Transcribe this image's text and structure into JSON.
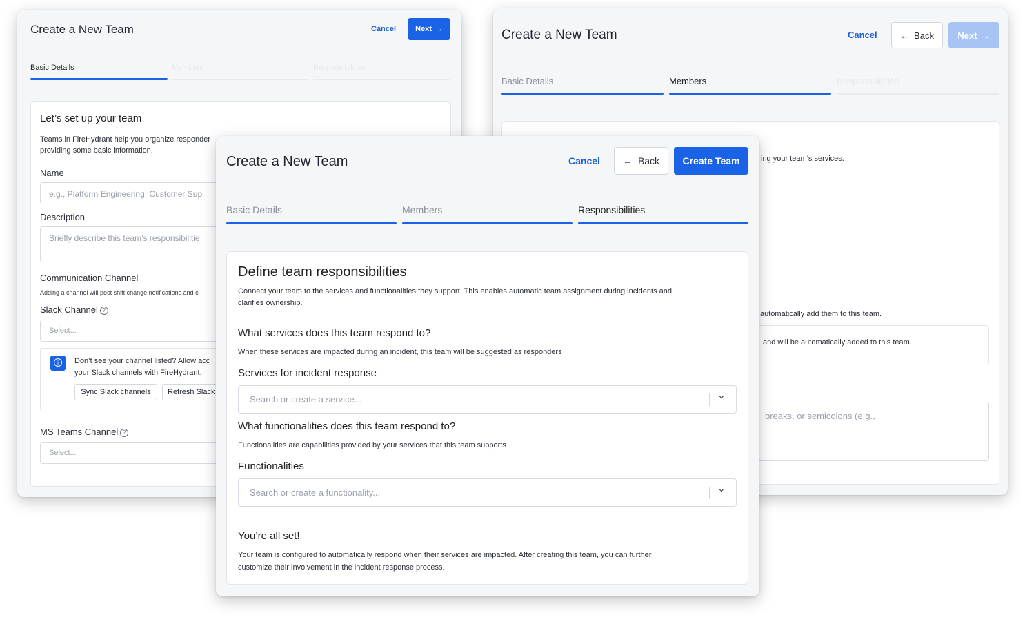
{
  "back_window_left": {
    "title": "Create a New Team",
    "cancel": "Cancel",
    "next": "Next",
    "tabs": [
      "Basic Details",
      "Members",
      "Responsibilities"
    ],
    "card_heading": "Let’s set up your team",
    "intro_line1": "Teams in FireHydrant help you organize responder",
    "intro_line2": "providing some basic information.",
    "name_label": "Name",
    "name_placeholder": "e.g., Platform Engineering, Customer Sup",
    "description_label": "Description",
    "description_placeholder": "Briefly describe this team’s responsibilitie",
    "comm_label": "Communication Channel",
    "comm_help": "Adding a channel will post shift change notifications and c",
    "slack_label": "Slack Channel",
    "slack_placeholder": "Select...",
    "info_line1": "Don’t see your channel listed? Allow acc",
    "info_line2": "your Slack channels with FireHydrant.",
    "sync_button": "Sync Slack channels",
    "refresh_button": "Refresh Slack",
    "ms_label": "MS Teams Channel",
    "ms_placeholder": "Select..."
  },
  "back_window_right": {
    "title": "Create a New Team",
    "cancel": "Cancel",
    "back": "Back",
    "next": "Next",
    "tabs": [
      "Basic Details",
      "Members",
      "Responsibilities"
    ],
    "text_services": "ing your team’s services.",
    "text_auto_add": "automatically add them to this team.",
    "text_added": "and will be automatically added to this team.",
    "text_breaks": "breaks, or semicolons (e.g.,"
  },
  "front_window": {
    "title": "Create a New Team",
    "cancel": "Cancel",
    "back": "Back",
    "create": "Create Team",
    "tabs": [
      "Basic Details",
      "Members",
      "Responsibilities"
    ],
    "heading": "Define team responsibilities",
    "intro_line1": "Connect your team to the services and functionalities they support. This enables automatic team assignment during incidents and",
    "intro_line2": "clarifies ownership.",
    "services_question": "What services does this team respond to?",
    "services_help": "When these services are impacted during an incident, this team will be suggested as responders",
    "services_label": "Services for incident response",
    "services_placeholder": "Search or create a service...",
    "func_question": "What functionalities does this team respond to?",
    "func_help": "Functionalities are capabilities provided by your services that this team supports",
    "func_label": "Functionalities",
    "func_placeholder": "Search or create a functionality...",
    "done_heading": "You’re all set!",
    "done_line1": "Your team is configured to automatically respond when their services are impacted. After creating this team, you can further",
    "done_line2": "customize their involvement in the incident response process."
  },
  "icons": {
    "arrow_right": "→",
    "arrow_left": "←",
    "chevron": "⌄",
    "info": "i",
    "help": "?"
  }
}
